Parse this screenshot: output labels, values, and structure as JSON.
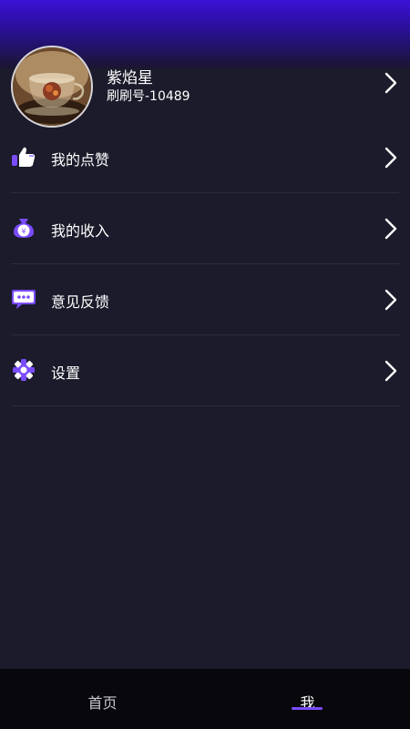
{
  "profile": {
    "name": "紫焰星",
    "id_text": "刷刷号-10489"
  },
  "menu": {
    "items": [
      {
        "label": "我的点赞",
        "icon": "thumbs-up-icon"
      },
      {
        "label": "我的收入",
        "icon": "money-bag-icon"
      },
      {
        "label": "意见反馈",
        "icon": "chat-bubble-icon"
      },
      {
        "label": "设置",
        "icon": "gear-icon"
      }
    ]
  },
  "tabs": {
    "home": "首页",
    "me": "我",
    "active": "me"
  },
  "colors": {
    "accent": "#7b4dff",
    "icon_purple": "#7a4cff",
    "top_gradient": "#3a11d6",
    "background": "#1b1b2b",
    "bottom_bar": "#08080c"
  }
}
